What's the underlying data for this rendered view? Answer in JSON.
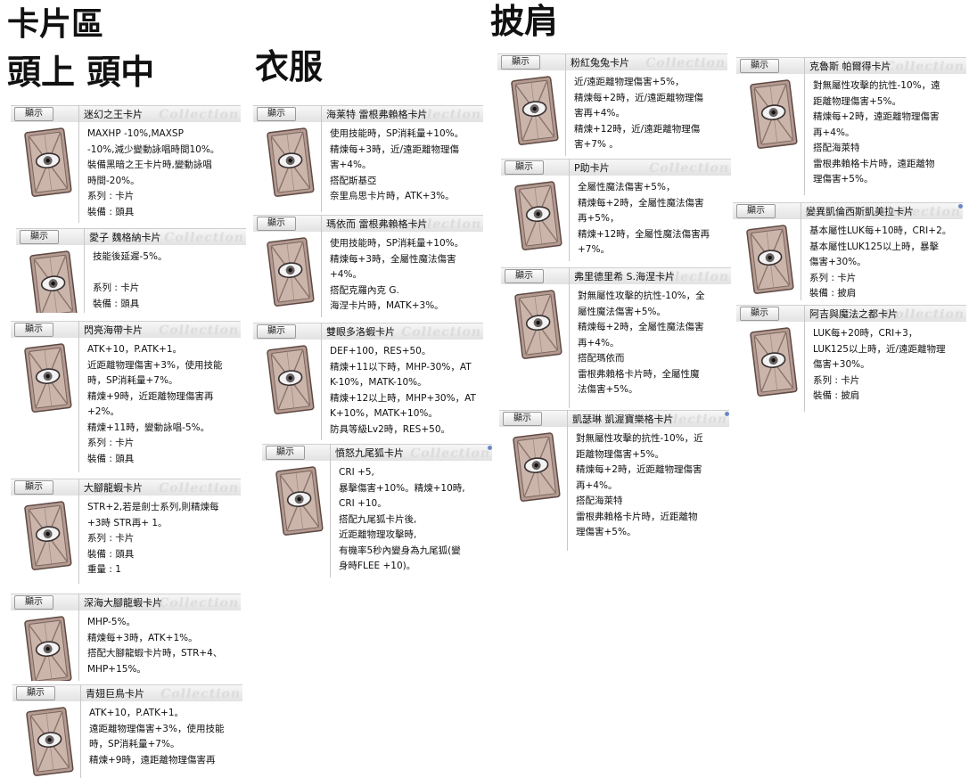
{
  "headings": {
    "card_area": "卡片區",
    "head": "頭上 頭中",
    "clothes": "衣服",
    "cape": "披肩"
  },
  "ui": {
    "show_label": "顯示",
    "watermark": "Collection"
  },
  "cards": [
    {
      "name": "迷幻之王卡片",
      "lines": [
        "MAXHP -10%,MAXSP",
        "-10%,減少變動詠唱時間10%。",
        "裝備黑暗之王卡片時,變動詠唱",
        "時間-20%。",
        "系列 : 卡片",
        "裝備 : 頭具"
      ]
    },
    {
      "name": "愛子 魏格納卡片",
      "lines": [
        "技能後延遲-5%。",
        "",
        "系列 : 卡片",
        "裝備 : 頭具"
      ]
    },
    {
      "name": "閃亮海帶卡片",
      "lines": [
        "ATK+10，P.ATK+1。",
        "近距離物理傷害+3%，使用技能",
        "時，SP消耗量+7%。",
        "精煉+9時，近距離物理傷害再",
        "+2%。",
        "精煉+11時，變動詠唱-5%。",
        "系列 : 卡片",
        "裝備 : 頭具"
      ]
    },
    {
      "name": "大腳龍蝦卡片",
      "lines": [
        "STR+2,若是劍士系列,則精煉每",
        "+3時 STR再+ 1。",
        "系列 : 卡片",
        "裝備 : 頭具",
        "重量 : 1"
      ]
    },
    {
      "name": "深海大腳龍蝦卡片",
      "lines": [
        "MHP-5%。",
        "精煉每+3時，ATK+1%。",
        "搭配大腳龍蝦卡片時，STR+4、",
        "MHP+15%。"
      ]
    },
    {
      "name": "青翅巨鳥卡片",
      "lines": [
        "ATK+10，P.ATK+1。",
        "遠距離物理傷害+3%，使用技能",
        "時，SP消耗量+7%。",
        "精煉+9時，遠距離物理傷害再"
      ]
    },
    {
      "name": "海莱特 雷根弗賴格卡片",
      "lines": [
        "使用技能時，SP消耗量+10%。",
        "精煉每+3時，近/遠距離物理傷",
        "害+4%。",
        "搭配斯基亞",
        "奈里烏思卡片時，ATK+3%。"
      ]
    },
    {
      "name": "瑪依而 雷根弗賴格卡片",
      "lines": [
        "使用技能時，SP消耗量+10%。",
        "精煉每+3時，全屬性魔法傷害",
        "+4%。",
        "搭配克羅內克 G.",
        "海涅卡片時，MATK+3%。"
      ]
    },
    {
      "name": "雙眼多洛蝦卡片",
      "lines": [
        "DEF+100，RES+50。",
        "精煉+11以下時，MHP-30%，AT",
        "K-10%，MATK-10%。",
        "精煉+12以上時，MHP+30%，AT",
        "K+10%，MATK+10%。",
        "防具等級Lv2時，RES+50。"
      ]
    },
    {
      "name": "憤怒九尾狐卡片",
      "lines": [
        "CRI +5,",
        "暴擊傷害+10%。精煉+10時,",
        "CRI +10。",
        "搭配九尾狐卡片後,",
        "近距離物理攻擊時,",
        "有機率5秒內變身為九尾狐(變",
        "身時FLEE +10)。"
      ]
    },
    {
      "name": "粉紅兔兔卡片",
      "lines": [
        "近/遠距離物理傷害+5%，",
        "精煉每+2時，近/遠距離物理傷",
        "害再+4%。",
        "精煉+12時，近/遠距離物理傷",
        "害+7% 。"
      ]
    },
    {
      "name": "P助卡片",
      "lines": [
        "全屬性魔法傷害+5%，",
        "精煉每+2時，全屬性魔法傷害",
        "再+5%，",
        "精煉+12時，全屬性魔法傷害再",
        "+7%。"
      ]
    },
    {
      "name": "弗里德里希 S.海涅卡片",
      "lines": [
        "對無屬性攻擊的抗性-10%，全",
        "屬性魔法傷害+5%。",
        "精煉每+2時，全屬性魔法傷害",
        "再+4%。",
        "搭配瑪依而",
        "雷根弗賴格卡片時，全屬性魔",
        "法傷害+5%。"
      ]
    },
    {
      "name": "凱瑟琳 凱渥寶樂格卡片",
      "lines": [
        "對無屬性攻擊的抗性-10%，近",
        "距離物理傷害+5%。",
        "精煉每+2時，近距離物理傷害",
        "再+4%。",
        "搭配海萊特",
        "雷根弗賴格卡片時，近距離物",
        "理傷害+5%。"
      ]
    },
    {
      "name": "克魯斯 帕爾得卡片",
      "lines": [
        "對無屬性攻擊的抗性-10%，遠",
        "距離物理傷害+5%。",
        "精煉每+2時，遠距離物理傷害",
        "再+4%。",
        "搭配海萊特",
        "雷根弗賴格卡片時，遠距離物",
        "理傷害+5%。"
      ]
    },
    {
      "name": "變異凱倫西斯凱美拉卡片",
      "lines": [
        "基本屬性LUK每+10時，CRI+2。",
        "基本屬性LUK125以上時，暴擊",
        "傷害+30%。",
        "系列 : 卡片",
        "裝備 : 披肩"
      ]
    },
    {
      "name": "阿吉與魔法之都卡片",
      "lines": [
        "LUK每+20時，CRI+3，",
        "LUK125以上時，近/遠距離物理",
        "傷害+30%。",
        "系列 : 卡片",
        "裝備 : 披肩"
      ]
    }
  ]
}
